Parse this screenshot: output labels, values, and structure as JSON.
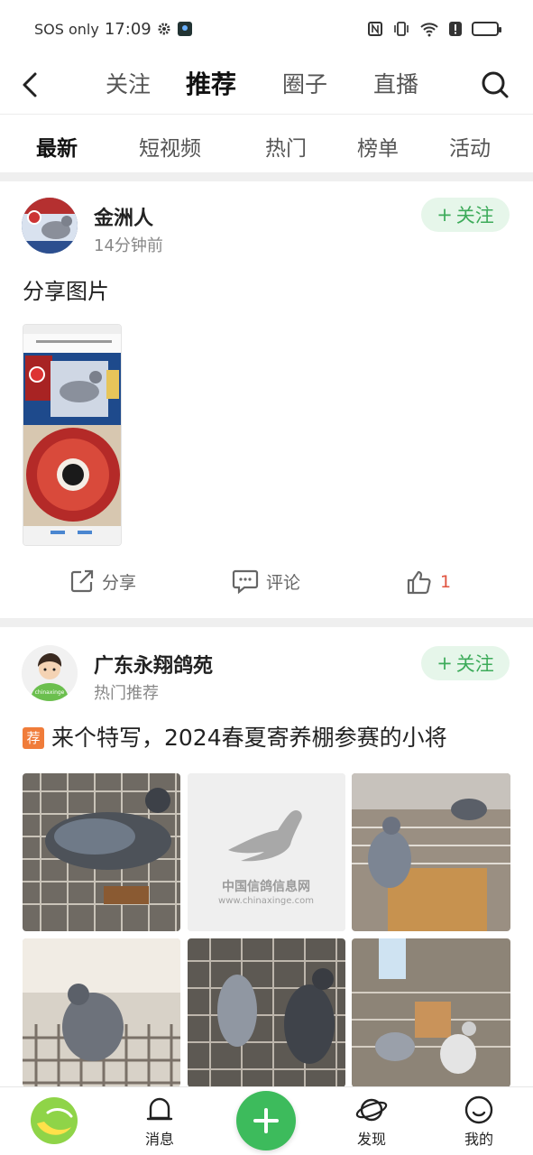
{
  "status_bar": {
    "carrier": "SOS only",
    "time": "17:09"
  },
  "top_nav": {
    "tabs": [
      {
        "label": "关注"
      },
      {
        "label": "推荐"
      },
      {
        "label": "圈子"
      },
      {
        "label": "直播"
      }
    ],
    "active_tab": "推荐"
  },
  "sub_tabs": {
    "items": [
      {
        "label": "最新"
      },
      {
        "label": "短视频"
      },
      {
        "label": "热门"
      },
      {
        "label": "榜单"
      },
      {
        "label": "活动"
      }
    ],
    "active": "最新"
  },
  "posts": [
    {
      "author": "金洲人",
      "subtitle": "14分钟前",
      "follow_label": "关注",
      "text": "分享图片",
      "share_label": "分享",
      "comment_label": "评论",
      "like_count": "1"
    },
    {
      "author": "广东永翔鸽苑",
      "subtitle": "热门推荐",
      "follow_label": "关注",
      "tag": "荐",
      "text": "来个特写，2024春夏寄养棚参赛的小将",
      "watermark_cn": "中国信鸽信息网",
      "watermark_url": "www.chinaxinge.com",
      "avatar_caption": "chinaxinge"
    }
  ],
  "bottom_nav": {
    "items": [
      {
        "label": "消息"
      },
      {
        "label": "发现"
      },
      {
        "label": "我的"
      }
    ]
  },
  "colors": {
    "accent": "#3dbb5c",
    "follow_bg": "#e6f6ea",
    "like": "#e0533f"
  }
}
